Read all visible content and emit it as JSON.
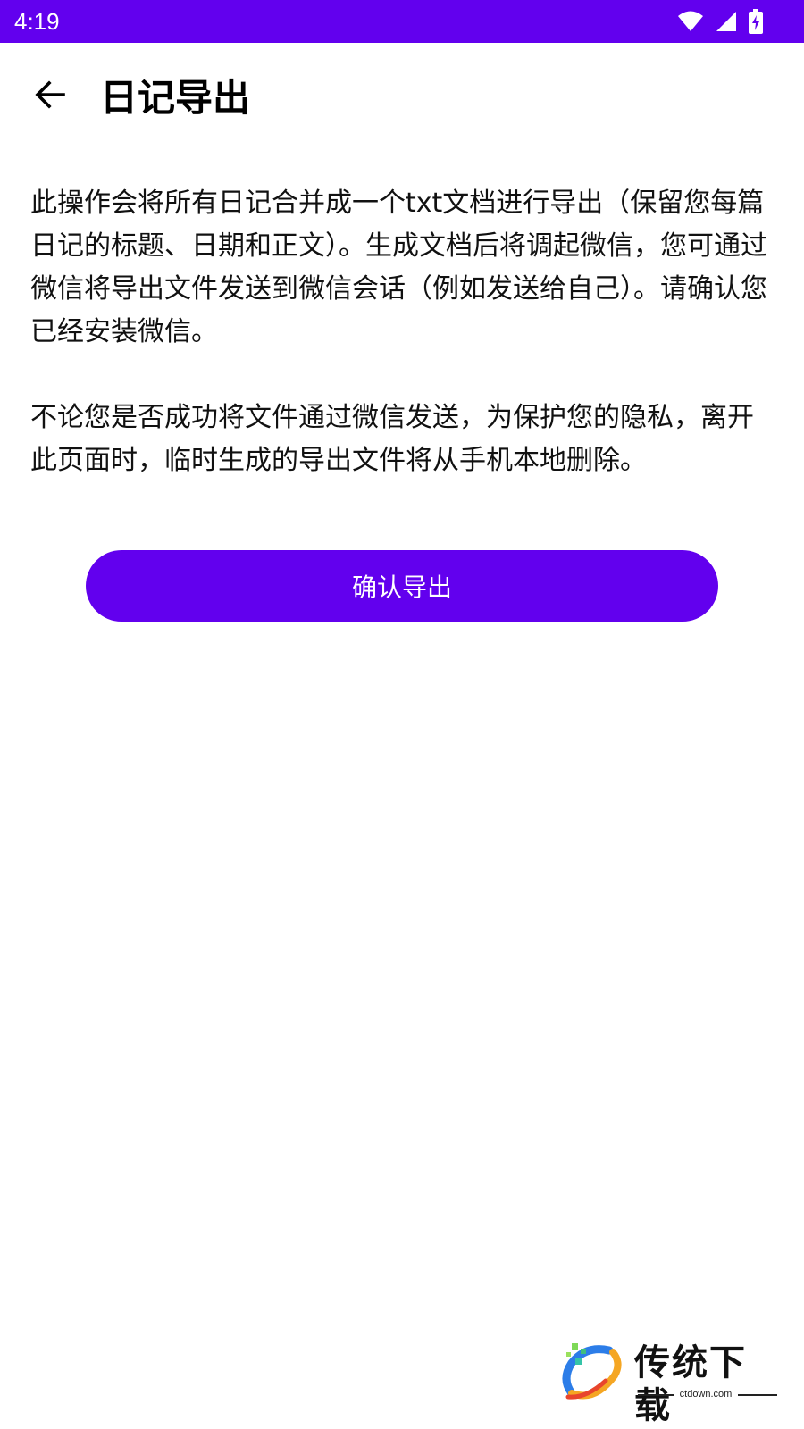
{
  "status_bar": {
    "time": "4:19",
    "background": "#6200ee",
    "icons": [
      "wifi-icon",
      "cell-signal-icon",
      "battery-charging-icon"
    ]
  },
  "toolbar": {
    "back_icon": "arrow-back-icon",
    "title": "日记导出"
  },
  "content": {
    "paragraph_1": "此操作会将所有日记合并成一个txt文档进行导出（保留您每篇日记的标题、日期和正文）。生成文档后将调起微信，您可通过微信将导出文件发送到微信会话（例如发送给自己）。请确认您已经安装微信。",
    "paragraph_2": "不论您是否成功将文件通过微信发送，为保护您的隐私，离开此页面时，临时生成的导出文件将从手机本地删除。"
  },
  "actions": {
    "confirm_label": "确认导出",
    "accent_color": "#6200ee"
  },
  "watermark": {
    "brand": "传统下载",
    "domain": "ctdown.com"
  }
}
